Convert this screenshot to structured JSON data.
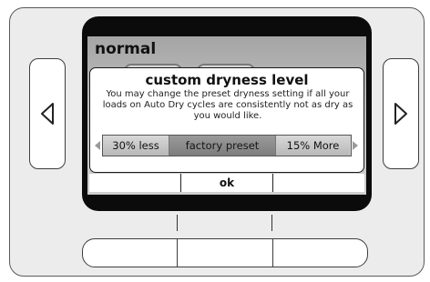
{
  "screen": {
    "title": "normal"
  },
  "dialog": {
    "title": "custom dryness level",
    "message": "You may change the preset dryness setting if all your loads on Auto Dry cycles are consistently not as dry as you would like."
  },
  "selector": {
    "options": [
      "30% less",
      "factory preset",
      "15% More"
    ],
    "selected": "factory preset"
  },
  "softkeys": [
    "",
    "ok",
    ""
  ],
  "icons": {
    "left_arrow": "triangle-left-icon",
    "right_arrow": "triangle-right-icon"
  }
}
